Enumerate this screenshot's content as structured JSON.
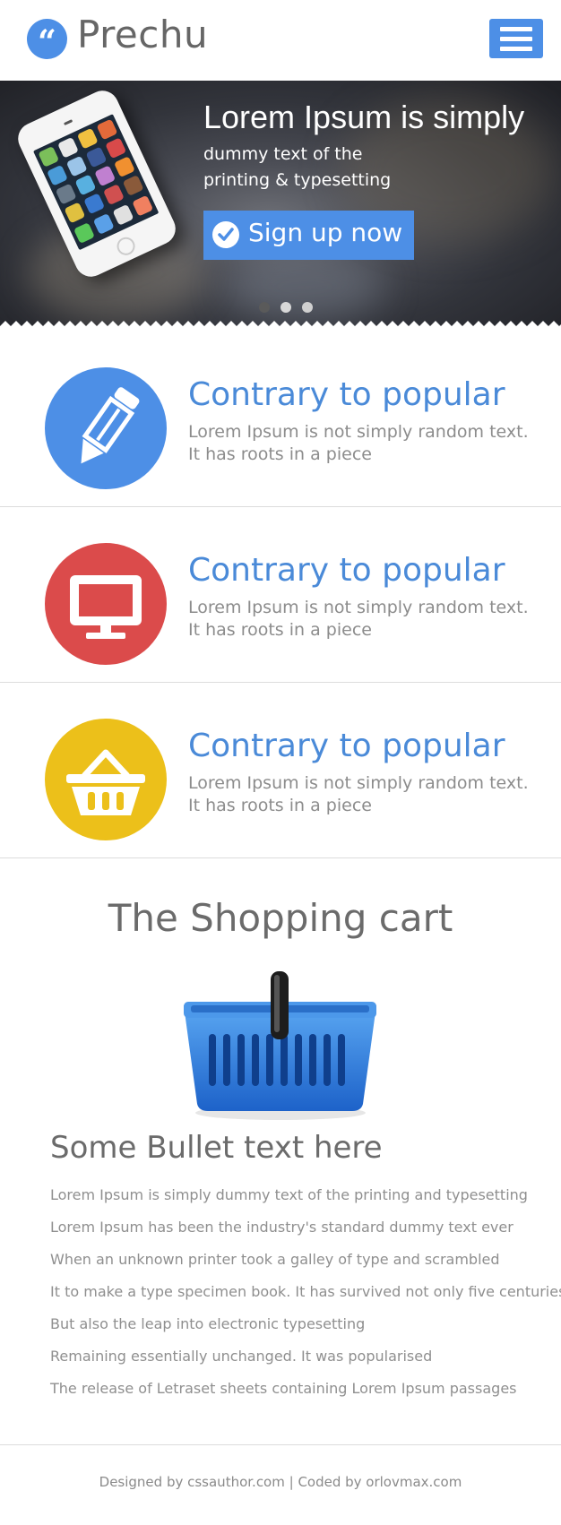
{
  "header": {
    "logo_glyph": "“",
    "brand": "Prechu",
    "accent_color": "#4d8fe6",
    "menu_icon": "hamburger-menu-icon"
  },
  "hero": {
    "title": "Lorem Ipsum is simply",
    "subtitle_line1": "dummy text of the",
    "subtitle_line2": "printing & typesetting",
    "cta_label": "Sign up now",
    "cta_icon": "checkmark-icon",
    "image_icon": "smartphone-icon",
    "slides_total": 3,
    "active_slide": 2
  },
  "features": [
    {
      "icon": "pencil-icon",
      "color": "#4d8fe6",
      "title": "Contrary to popular",
      "desc_line1": "Lorem Ipsum is not simply random text.",
      "desc_line2": "It has roots in a piece"
    },
    {
      "icon": "monitor-icon",
      "color": "#db4b4b",
      "title": "Contrary to popular",
      "desc_line1": "Lorem Ipsum is not simply random text.",
      "desc_line2": "It has roots in a piece"
    },
    {
      "icon": "basket-icon",
      "color": "#ecc01a",
      "title": "Contrary to popular",
      "desc_line1": "Lorem Ipsum is not simply random text.",
      "desc_line2": "It has roots in a piece"
    }
  ],
  "cart": {
    "heading": "The Shopping cart",
    "illustration": "shopping-basket-icon",
    "bullet_heading": "Some Bullet text here",
    "bullets": [
      "Lorem Ipsum is simply dummy text of the printing and typesetting",
      "Lorem Ipsum has been the industry's standard dummy text ever",
      "When an unknown printer took a galley of type and scrambled",
      "It to make a type specimen book. It has survived not only five centuries",
      "But also the leap into electronic typesetting",
      "Remaining essentially unchanged. It was popularised",
      "The release of Letraset sheets containing Lorem Ipsum passages"
    ]
  },
  "footer": {
    "text": "Designed by cssauthor.com | Coded by orlovmax.com"
  }
}
